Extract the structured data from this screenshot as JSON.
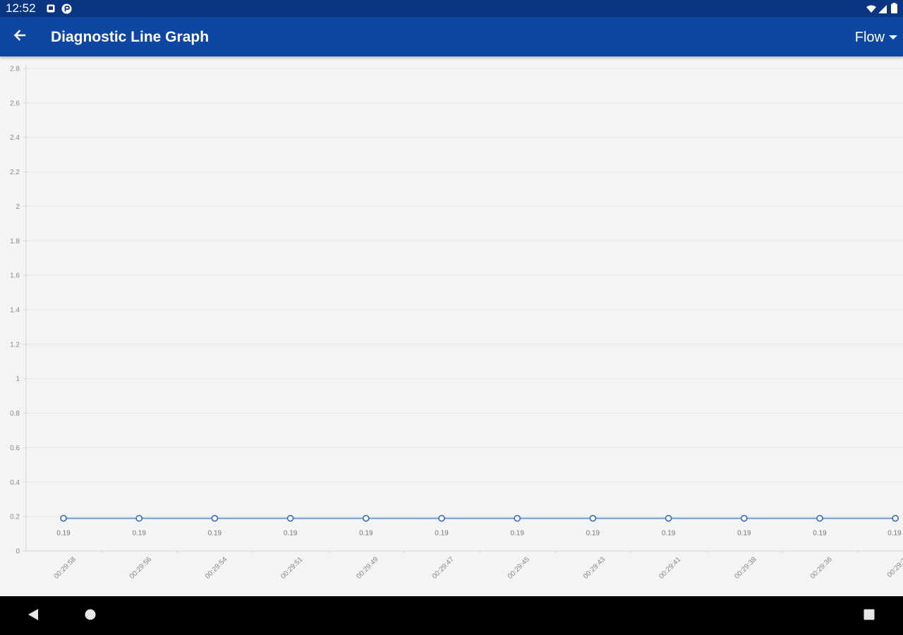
{
  "status_bar": {
    "time": "12:52",
    "icons": [
      "notification-square-icon",
      "media-icon",
      "wifi-icon",
      "signal-icon",
      "battery-icon"
    ]
  },
  "app_bar": {
    "title": "Diagnostic Line Graph",
    "back_icon": "arrow-back-icon",
    "dropdown": {
      "selected": "Flow",
      "icon": "chevron-down-icon"
    }
  },
  "colors": {
    "status_bar": "#0a3580",
    "app_bar": "#0d47a1",
    "series_line": "#6e9ad8",
    "marker_stroke": "#2a62b5"
  },
  "chart_data": {
    "type": "line",
    "ylim": [
      0,
      2.8
    ],
    "y_ticks": [
      "0",
      "0.2",
      "0.4",
      "0.6",
      "0.8",
      "1",
      "1.2",
      "1.4",
      "1.6",
      "1.8",
      "2",
      "2.2",
      "2.4",
      "2.6",
      "2.8"
    ],
    "x": [
      "00:29:58",
      "00:29:56",
      "00:29:54",
      "00:29:51",
      "00:29:49",
      "00:29:47",
      "00:29:45",
      "00:29:43",
      "00:29:41",
      "00:29:38",
      "00:29:36",
      "00:29:3"
    ],
    "series": [
      {
        "values": [
          0.19,
          0.19,
          0.19,
          0.19,
          0.19,
          0.19,
          0.19,
          0.19,
          0.19,
          0.19,
          0.19,
          0.19
        ]
      }
    ],
    "data_labels": [
      "0.19",
      "0.19",
      "0.19",
      "0.19",
      "0.19",
      "0.19",
      "0.19",
      "0.19",
      "0.19",
      "0.19",
      "0.19",
      "0.19"
    ],
    "grid": true,
    "legend": "none"
  },
  "nav_bar": {
    "buttons": [
      "back-triangle-icon",
      "home-circle-icon",
      "recents-square-icon"
    ]
  }
}
